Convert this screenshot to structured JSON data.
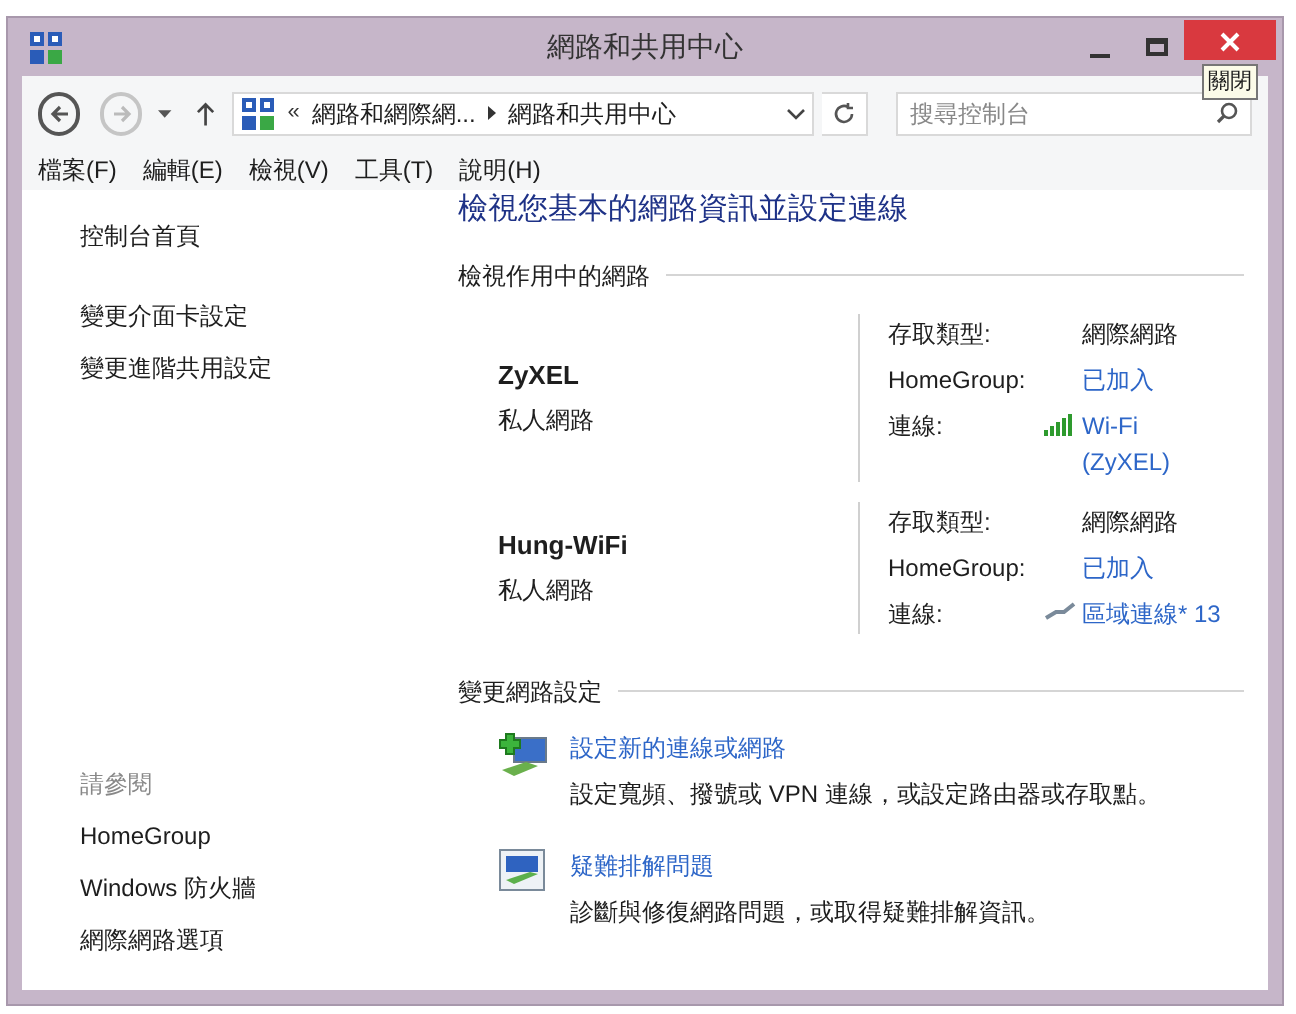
{
  "window": {
    "title": "網路和共用中心",
    "tooltip": "關閉"
  },
  "address": {
    "separator": "«",
    "crumbs": [
      "網路和網際網...",
      "網路和共用中心"
    ],
    "search_placeholder": "搜尋控制台"
  },
  "menu": [
    "檔案(F)",
    "編輯(E)",
    "檢視(V)",
    "工具(T)",
    "說明(H)"
  ],
  "sidebar": {
    "top": [
      "控制台首頁"
    ],
    "links": [
      "變更介面卡設定",
      "變更進階共用設定"
    ],
    "see_also_title": "請參閱",
    "see_also": [
      "HomeGroup",
      "Windows 防火牆",
      "網際網路選項"
    ]
  },
  "heading": "檢視您基本的網路資訊並設定連線",
  "active_section": "檢視作用中的網路",
  "networks": [
    {
      "name": "ZyXEL",
      "category": "私人網路",
      "rows": [
        {
          "label": "存取類型:",
          "value": "網際網路",
          "link": false
        },
        {
          "label": "HomeGroup:",
          "value": "已加入",
          "link": true
        },
        {
          "label": "連線:",
          "value": "Wi-Fi (ZyXEL)",
          "link": true,
          "kind": "wifi"
        }
      ]
    },
    {
      "name": "Hung-WiFi",
      "category": "私人網路",
      "rows": [
        {
          "label": "存取類型:",
          "value": "網際網路",
          "link": false
        },
        {
          "label": "HomeGroup:",
          "value": "已加入",
          "link": true
        },
        {
          "label": "連線:",
          "value": "區域連線* 13",
          "link": true,
          "kind": "cable"
        }
      ]
    }
  ],
  "change_section": "變更網路設定",
  "tasks": [
    {
      "kind": "new",
      "title": "設定新的連線或網路",
      "desc": "設定寬頻、撥號或 VPN 連線，或設定路由器或存取點。"
    },
    {
      "kind": "troubleshoot",
      "title": "疑難排解問題",
      "desc": "診斷與修復網路問題，或取得疑難排解資訊。"
    }
  ]
}
